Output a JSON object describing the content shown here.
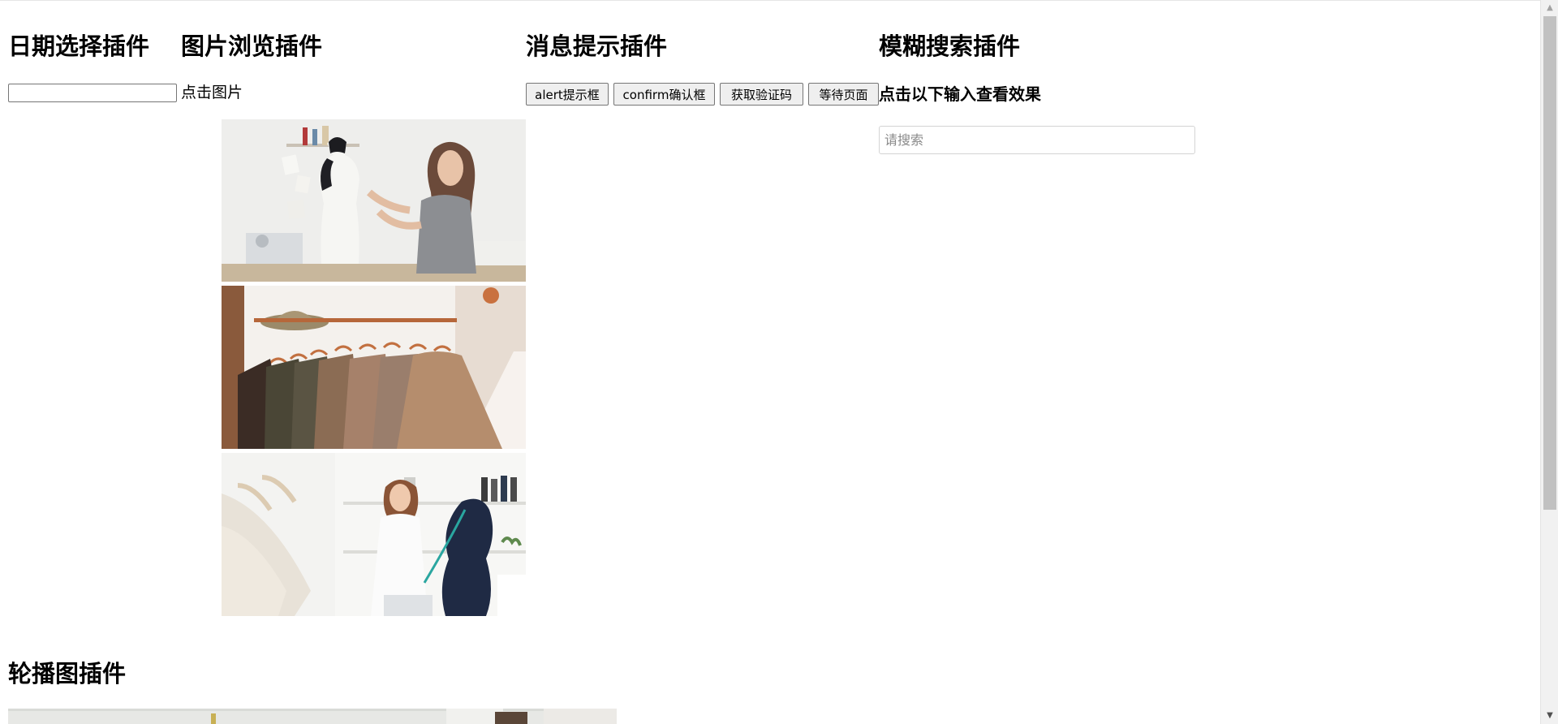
{
  "sections": {
    "date": "日期选择插件",
    "image_viewer": "图片浏览插件",
    "message": "消息提示插件",
    "fuzzy_search": "模糊搜索插件",
    "carousel": "轮播图插件"
  },
  "date_picker": {
    "value": ""
  },
  "image_viewer": {
    "label": "点击图片",
    "images": [
      {
        "subject": "tailor fitting a dress on a mannequin"
      },
      {
        "subject": "jackets on copper hangers on a clothing rack"
      },
      {
        "subject": "smiling seamstress measuring a mannequin"
      }
    ]
  },
  "message": {
    "buttons": [
      "alert提示框",
      "confirm确认框",
      "获取验证码",
      "等待页面"
    ]
  },
  "fuzzy_search": {
    "hint": "点击以下输入查看效果",
    "placeholder": "请搜索",
    "value": ""
  },
  "icons": {
    "scroll_up": "triangle-up",
    "scroll_down": "triangle-down"
  }
}
